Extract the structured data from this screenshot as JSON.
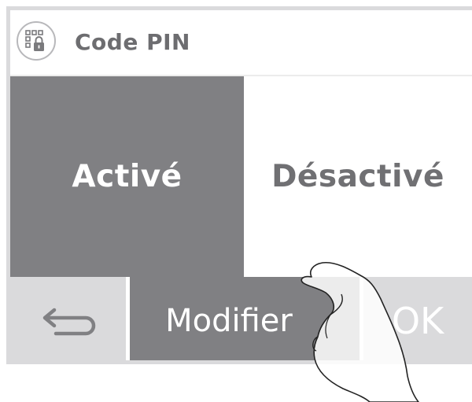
{
  "header": {
    "title": "Code PIN",
    "icon": "pin-lock-icon"
  },
  "options": {
    "active_label": "Activé",
    "inactive_label": "Désactivé",
    "selected": "active"
  },
  "bottom_bar": {
    "back_icon": "back-arrow-icon",
    "modify_label": "Modifier",
    "ok_label": "OK"
  },
  "colors": {
    "selected_bg": "#808083",
    "unselected_bg": "#ffffff",
    "button_bg": "#dadadc",
    "title_text": "#6d6d70",
    "frame": "#dadadc"
  }
}
